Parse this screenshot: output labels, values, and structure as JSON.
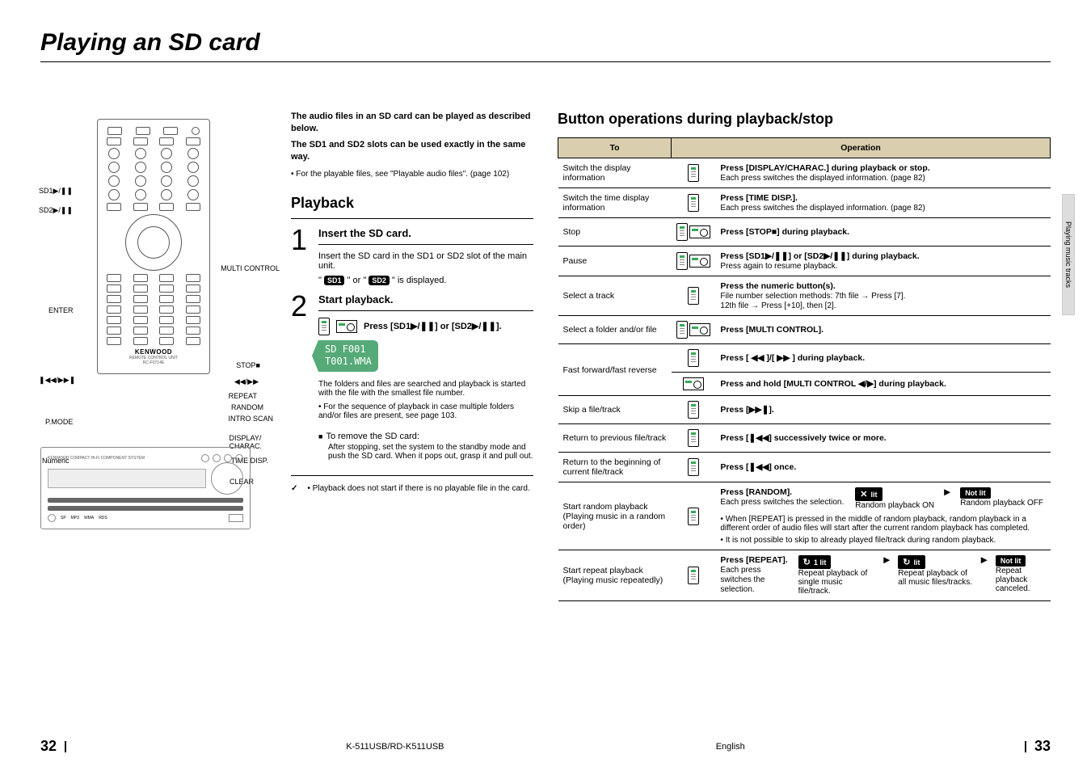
{
  "title": "Playing an SD card",
  "side_tab": "Playing music tracks",
  "remote_labels": {
    "sd1": "SD1▶/❚❚",
    "sd2": "SD2▶/❚❚",
    "enter": "ENTER",
    "skip": "❚◀◀/▶▶❚",
    "pmode": "P.MODE",
    "numeric": "Numeric",
    "multi": "MULTI CONTROL",
    "stop": "STOP■",
    "rewff": "◀◀/▶▶",
    "repeat": "REPEAT",
    "random": "RANDOM",
    "intro": "INTRO SCAN",
    "display": "DISPLAY/\nCHARAC.",
    "time": "TIME DISP.",
    "clear": "CLEAR",
    "brand": "KENWOOD",
    "brand_sub": "REMOTE CONTROL UNIT\nRC-F0714E"
  },
  "intro": {
    "l1": "The audio files in an SD card can be played as described below.",
    "l2": "The SD1 and SD2 slots can be used exactly in the same way.",
    "l3": "For the playable files, see \"Playable audio files\". (page 102)"
  },
  "playback_h": "Playback",
  "step1": {
    "title": "Insert the SD card.",
    "body": "Insert the SD card in the SD1 or SD2 slot of the main unit.",
    "badge_line_a": "\" ",
    "badge1": "SD1",
    "badge_line_b": " \" or \" ",
    "badge2": "SD2",
    "badge_line_c": " \" is displayed."
  },
  "step2": {
    "title": "Start playback.",
    "press": "Press [SD1▶/❚❚] or [SD2▶/❚❚].",
    "lcd1": "SD F001",
    "lcd2": "T001.WMA",
    "after1": "The folders and files are searched and playback is started with the file with the smallest file number.",
    "after2": "For the sequence of playback in case multiple folders and/or files are present, see page 103.",
    "remove_h": "To remove the SD card:",
    "remove_b": "After stopping, set the system to the standby mode and push the SD card. When it pops out, grasp it and pull out."
  },
  "check_note": "Playback does not start if there is no playable file in the card.",
  "right_h": "Button operations during playback/stop",
  "table": {
    "th_to": "To",
    "th_op": "Operation",
    "rows": [
      {
        "to": "Switch the display information",
        "icons": [
          "r"
        ],
        "op": "Press [DISPLAY/CHARAC.] during playback or stop.",
        "sub": "Each press switches the displayed information. (page 82)"
      },
      {
        "to": "Switch the time display information",
        "icons": [
          "r"
        ],
        "op": "Press [TIME DISP.].",
        "sub": "Each press switches the displayed information. (page 82)"
      },
      {
        "to": "Stop",
        "icons": [
          "r",
          "u"
        ],
        "op": "Press [STOP■] during playback."
      },
      {
        "to": "Pause",
        "icons": [
          "r",
          "u"
        ],
        "op": "Press [SD1▶/❚❚] or [SD2▶/❚❚] during playback.",
        "sub": "Press again to resume playback."
      },
      {
        "to": "Select a track",
        "icons": [
          "r"
        ],
        "op": "Press the numeric button(s).",
        "sub": "File number selection methods:  7th file → Press [7].\n                                                                 12th file → Press [+10], then [2]."
      },
      {
        "to": "Select a folder and/or file",
        "icons": [
          "r",
          "u"
        ],
        "op": "Press [MULTI CONTROL]."
      },
      {
        "to": "Fast forward/fast reverse",
        "icons": [
          "r"
        ],
        "op": "Press [ ◀◀ ]/[ ▶▶ ] during playback.",
        "split": true,
        "icons2": [
          "u"
        ],
        "op2": "Press and hold [MULTI CONTROL ◀/▶] during playback."
      },
      {
        "to": "Skip a file/track",
        "icons": [
          "r"
        ],
        "op": "Press [▶▶❚]."
      },
      {
        "to": "Return to previous file/track",
        "icons": [
          "r"
        ],
        "op": "Press [❚◀◀] successively twice or more."
      },
      {
        "to": "Return to the beginning of current file/track",
        "icons": [
          "r"
        ],
        "op": "Press [❚◀◀] once."
      }
    ],
    "random": {
      "to": "Start random playback\n(Playing music in a random order)",
      "op": "Press [RANDOM].",
      "sub": "Each press switches the selection.",
      "state1": "lit",
      "state1_desc": "Random playback ON",
      "state2": "Not lit",
      "state2_desc": "Random playback OFF",
      "note1": "When [REPEAT] is pressed in the middle of random playback, random playback in a different order of audio files will start after the current random playback has completed.",
      "note2": "It is not possible to skip to already played file/track during random playback."
    },
    "repeat": {
      "to": "Start repeat playback\n(Playing music repeatedly)",
      "op": "Press [REPEAT].",
      "sub": "Each press switches the selection.",
      "s1": "1 lit",
      "d1": "Repeat playback of single music file/track.",
      "s2": "lit",
      "d2": "Repeat playback of all music files/tracks.",
      "s3": "Not lit",
      "d3": "Repeat playback canceled."
    }
  },
  "footer": {
    "left_page": "32",
    "model": "K-511USB/RD-K511USB",
    "lang": "English",
    "right_page": "33"
  }
}
